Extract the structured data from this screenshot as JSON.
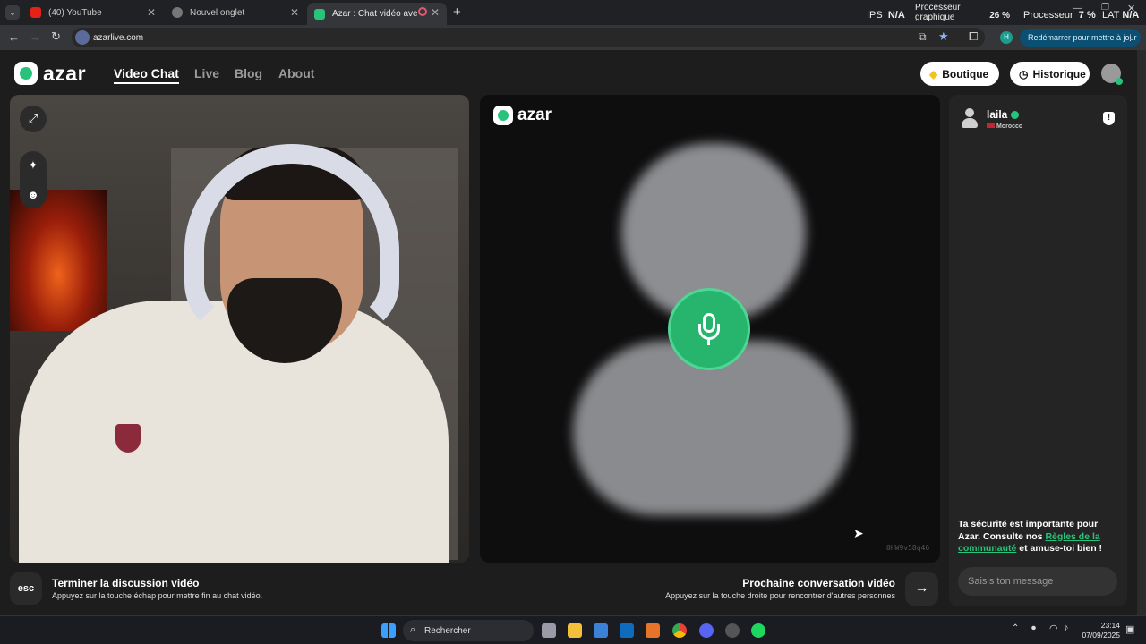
{
  "browser": {
    "tabs": [
      {
        "label": "(40) YouTube"
      },
      {
        "label": "Nouvel onglet"
      },
      {
        "label": "Azar : Chat vidéo avec de n"
      }
    ],
    "url": "azarlive.com",
    "update_label": "Redémarrer pour mettre à jour",
    "profile_initial": "H",
    "perf": {
      "ips_label": "IPS",
      "ips_value": "N/A",
      "gpu_label_1": "Processeur",
      "gpu_label_2": "graphique",
      "gpu_value": "26 %",
      "cpu_label": "Processeur",
      "cpu_value": "7 %",
      "lat_label": "LAT",
      "lat_value": "N/A"
    }
  },
  "site": {
    "logo": "azar",
    "nav": [
      "Video Chat",
      "Live",
      "Blog",
      "About"
    ],
    "boutique": "Boutique",
    "historique": "Historique",
    "partner_watermark": "azar",
    "session_code": "0HW9v58q46",
    "partner": {
      "name": "laila",
      "country": "Morocco"
    },
    "safety_text_1": "Ta sécurité est importante pour Azar. Consulte nos ",
    "safety_link": "Règles de la communauté",
    "safety_text_2": " et amuse-toi bien !",
    "message_placeholder": "Saisis ton message",
    "esc_key": "esc",
    "end_title": "Terminer la discussion vidéo",
    "end_sub": "Appuyez sur la touche échap pour mettre fin au chat vidéo.",
    "next_title": "Prochaine conversation vidéo",
    "next_sub": "Appuyez sur la touche droite pour rencontrer d'autres personnes"
  },
  "taskbar": {
    "search": "Rechercher",
    "time": "23:14",
    "date": "07/09/2025"
  },
  "colors": {
    "accent": "#28c27a",
    "page_bg": "#1d1d1d"
  }
}
